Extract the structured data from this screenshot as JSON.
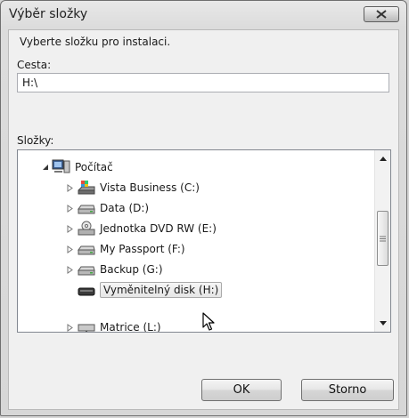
{
  "window": {
    "title": "Výběr složky"
  },
  "instruction": "Vyberte složku pro instalaci.",
  "path": {
    "label": "Cesta:",
    "value": "H:\\"
  },
  "folders": {
    "label": "Složky:",
    "items": [
      {
        "label": "Počítač",
        "icon": "computer-icon",
        "expanded": true
      },
      {
        "label": "Vista Business (C:)",
        "icon": "system-drive-icon"
      },
      {
        "label": "Data (D:)",
        "icon": "hard-drive-icon"
      },
      {
        "label": "Jednotka DVD RW (E:)",
        "icon": "dvd-drive-icon"
      },
      {
        "label": "My Passport (F:)",
        "icon": "hard-drive-icon"
      },
      {
        "label": "Backup (G:)",
        "icon": "hard-drive-icon"
      },
      {
        "label": "Vyměnitelný disk (H:)",
        "icon": "removable-disk-icon",
        "selected": true
      },
      {
        "label": "Matrice (L:)",
        "icon": "network-drive-icon"
      }
    ]
  },
  "buttons": {
    "ok": "OK",
    "cancel": "Storno"
  },
  "colors": {
    "accent": "#d6d6d6",
    "selection": "#e6e6e6"
  }
}
